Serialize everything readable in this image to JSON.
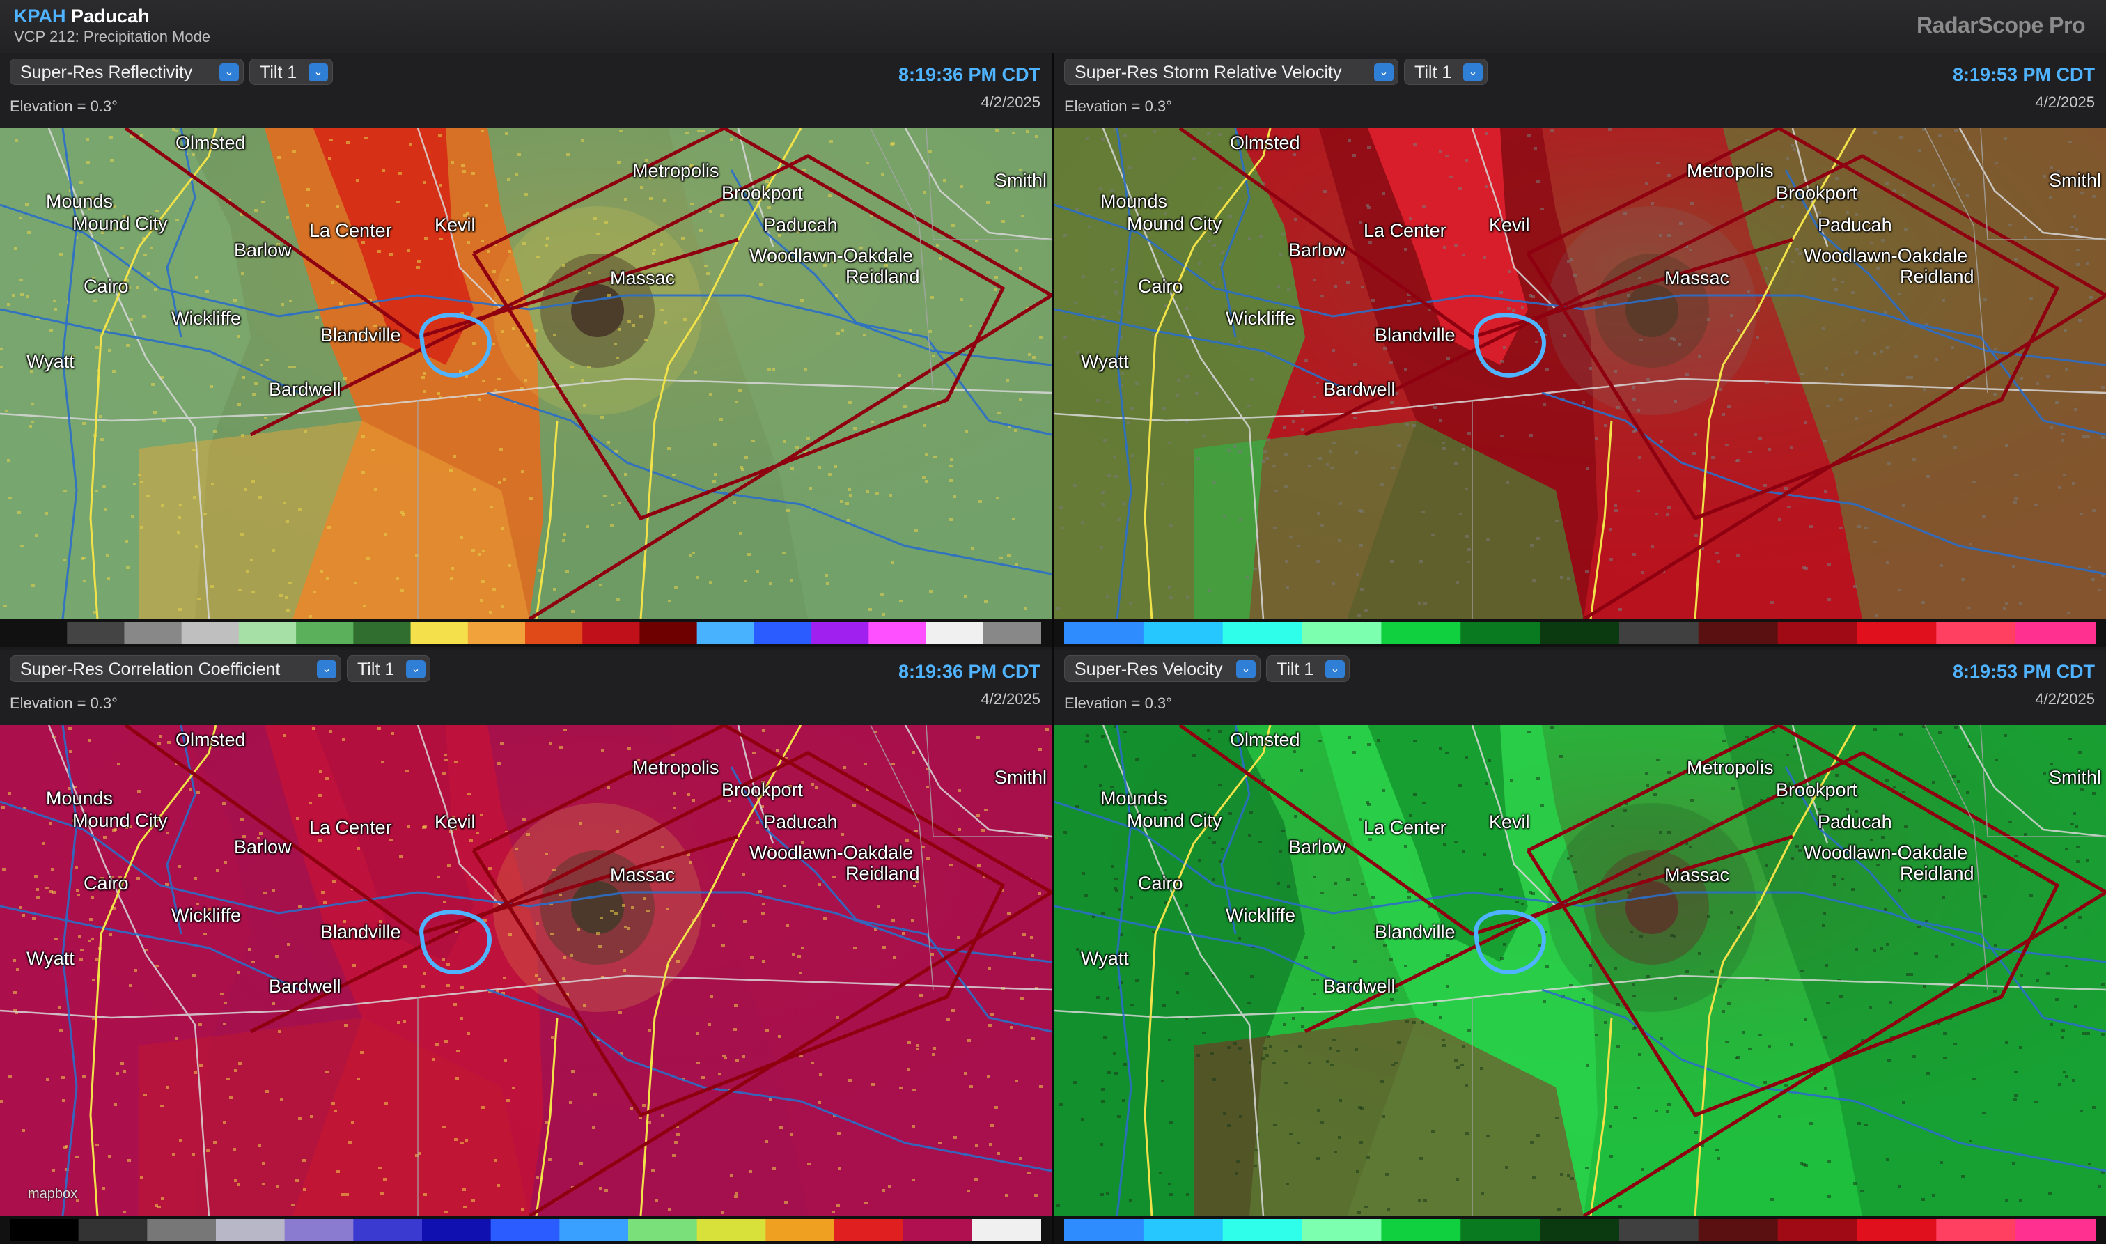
{
  "header": {
    "site_id": "KPAH",
    "site_name": "Paducah",
    "vcp": "VCP 212: Precipitation Mode",
    "brand": "RadarScope Pro"
  },
  "panels": [
    {
      "product": "Super-Res Reflectivity",
      "tilt": "Tilt 1",
      "elevation": "Elevation = 0.3°",
      "time": "8:19:36 PM CDT",
      "date": "4/2/2025",
      "colors": {
        "base": "#6e9a64",
        "band_a": "#e86a1c",
        "band_b": "#d62a16",
        "band_c": "#f0a83a",
        "ring": "#4a3a2a",
        "outer": "#7fb076",
        "stipple": "#e8d44c"
      },
      "scale_colors": [
        "#111111",
        "#444444",
        "#888888",
        "#bfbfbf",
        "#a6e0a6",
        "#5bb05b",
        "#2f6e2f",
        "#f4e04a",
        "#f2a23a",
        "#e04a18",
        "#c0101a",
        "#6e0000",
        "#49b2ff",
        "#2b5cff",
        "#a020f0",
        "#ff50ff",
        "#f0f0f0",
        "#888888"
      ]
    },
    {
      "product": "Super-Res Storm Relative Velocity",
      "tilt": "Tilt 1",
      "elevation": "Elevation = 0.3°",
      "time": "8:19:53 PM CDT",
      "date": "4/2/2025",
      "colors": {
        "base": "#b8121e",
        "band_a": "#8e0a14",
        "band_b": "#e0202c",
        "band_c": "#1ec84a",
        "ring": "#5a3a2a",
        "outer": "#20d24a",
        "stipple": "#7a7a7a"
      },
      "scale_colors": [
        "#2f8cff",
        "#26c6ff",
        "#2fffea",
        "#7dffb0",
        "#10d040",
        "#0a7a20",
        "#0c3a10",
        "#404040",
        "#5a1010",
        "#a00a14",
        "#e0101c",
        "#ff4060",
        "#ff3090"
      ]
    },
    {
      "product": "Super-Res Correlation Coefficient",
      "tilt": "Tilt 1",
      "elevation": "Elevation = 0.3°",
      "time": "8:19:36 PM CDT",
      "date": "4/2/2025",
      "colors": {
        "base": "#a4104e",
        "band_a": "#c2123a",
        "band_b": "#b0103f",
        "band_c": "#c41a2c",
        "ring": "#4a3a2a",
        "outer": "#b0104a",
        "stipple": "#f2d14a"
      },
      "scale_colors": [
        "#000000",
        "#333333",
        "#777777",
        "#b7b7c8",
        "#8a7ad0",
        "#3a3ad0",
        "#1010b0",
        "#2a5cff",
        "#3aa0ff",
        "#7ae07a",
        "#d8e03a",
        "#f0a020",
        "#e02020",
        "#b01050",
        "#f0f0f0"
      ]
    },
    {
      "product": "Super-Res Velocity",
      "tilt": "Tilt 1",
      "elevation": "Elevation = 0.3°",
      "time": "8:19:53 PM CDT",
      "date": "4/2/2025",
      "colors": {
        "base": "#1fbf3e",
        "band_a": "#29d24a",
        "band_b": "#159a30",
        "band_c": "#a0101c",
        "ring": "#5a3a2a",
        "outer": "#0a6a20",
        "stipple": "#1a3a1a"
      },
      "scale_colors": [
        "#2f8cff",
        "#26c6ff",
        "#2fffea",
        "#7dffb0",
        "#10d040",
        "#0a7a20",
        "#0c3a10",
        "#404040",
        "#5a1010",
        "#a00a14",
        "#e0101c",
        "#ff4060",
        "#ff3090"
      ]
    }
  ],
  "cities": [
    {
      "name": "Olmsted"
    },
    {
      "name": "Metropolis"
    },
    {
      "name": "Smithl"
    },
    {
      "name": "Mounds"
    },
    {
      "name": "Brookport"
    },
    {
      "name": "Mound City"
    },
    {
      "name": "La Center"
    },
    {
      "name": "Kevil"
    },
    {
      "name": "Paducah"
    },
    {
      "name": "Barlow"
    },
    {
      "name": "Woodlawn-Oakdale"
    },
    {
      "name": "Massac"
    },
    {
      "name": "Reidland"
    },
    {
      "name": "Cairo"
    },
    {
      "name": "Wickliffe"
    },
    {
      "name": "Blandville"
    },
    {
      "name": "Wyatt"
    },
    {
      "name": "Bardwell"
    }
  ],
  "attribution": "mapbox"
}
